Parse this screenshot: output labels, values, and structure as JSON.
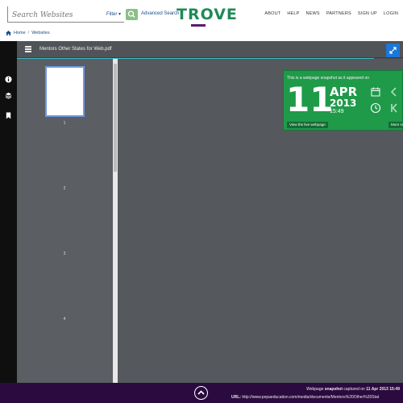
{
  "header": {
    "search_placeholder": "Search Websites",
    "filter_label": "Filter ▾",
    "advanced_search": "Advanced Search",
    "logo": "TROVE",
    "nav": [
      "ABOUT",
      "HELP",
      "NEWS",
      "PARTNERS",
      "SIGN UP",
      "LOGIN"
    ]
  },
  "breadcrumb": {
    "home": "Home",
    "separator": "/",
    "current": "Websites"
  },
  "viewer": {
    "document_title": "Mentors Other States for Web.pdf",
    "page_numbers": [
      "1",
      "2",
      "3",
      "4"
    ]
  },
  "snapshot": {
    "caption": "This is a webpage snapshot as it appeared on",
    "day": "11",
    "month": "APR",
    "year": "2013",
    "time": "15:49",
    "live_button": "View the live webpage",
    "more_button": "More sn"
  },
  "footer": {
    "capture_prefix": "Webpage ",
    "capture_bold": "snapshot",
    "capture_middle": " captured on ",
    "capture_date": "11 Apr 2013 15:49",
    "url_label": "URL:",
    "url_value": "http://www.pepaeducation.com/media/documents/Mentors%20Other%20Stat"
  },
  "colors": {
    "brand_green": "#1f9a49",
    "brand_purple": "#2b0b3f",
    "accent_blue": "#1d77d6"
  }
}
